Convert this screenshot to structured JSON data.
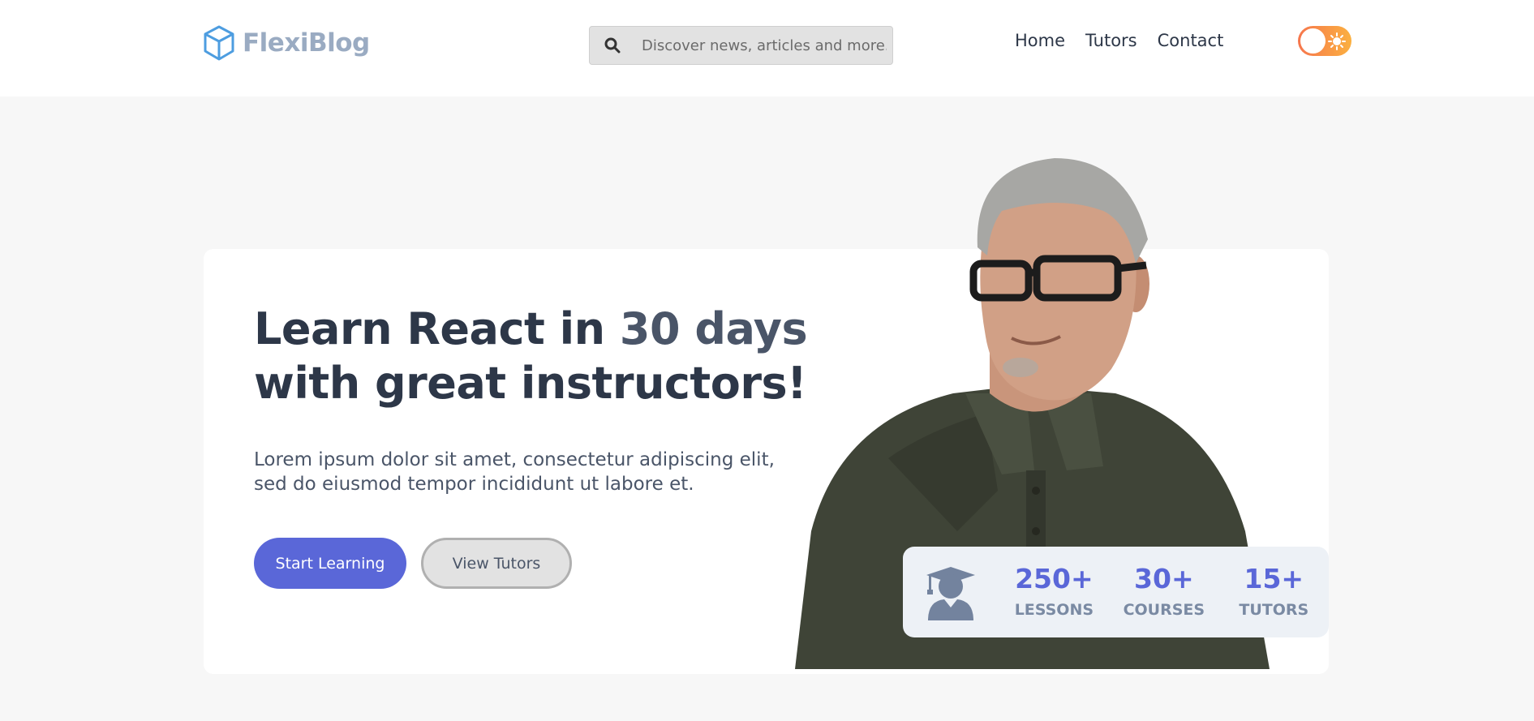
{
  "brand": {
    "name": "FlexiBlog",
    "logo_icon": "cube-icon",
    "color": "#9aabc2"
  },
  "search": {
    "placeholder": "Discover news, articles and more.",
    "icon": "search-icon"
  },
  "nav": {
    "items": [
      {
        "label": "Home"
      },
      {
        "label": "Tutors"
      },
      {
        "label": "Contact"
      }
    ]
  },
  "theme_toggle": {
    "icon": "sun-icon",
    "state": "light"
  },
  "hero": {
    "title_part1": "Learn React in ",
    "title_accent": "30 days",
    "title_part2": "with great instructors!",
    "description": "Lorem ipsum dolor sit amet, consectetur adipiscing elit, sed do eiusmod tempor incididunt ut labore et.",
    "primary_button": "Start Learning",
    "secondary_button": "View Tutors"
  },
  "stats": {
    "icon": "graduate-icon",
    "items": [
      {
        "value": "250+",
        "label": "LESSONS"
      },
      {
        "value": "30+",
        "label": "COURSES"
      },
      {
        "value": "15+",
        "label": "TUTORS"
      }
    ]
  },
  "colors": {
    "accent": "#5a67d8",
    "toggle_start": "#f6764d",
    "toggle_end": "#fbb040"
  }
}
